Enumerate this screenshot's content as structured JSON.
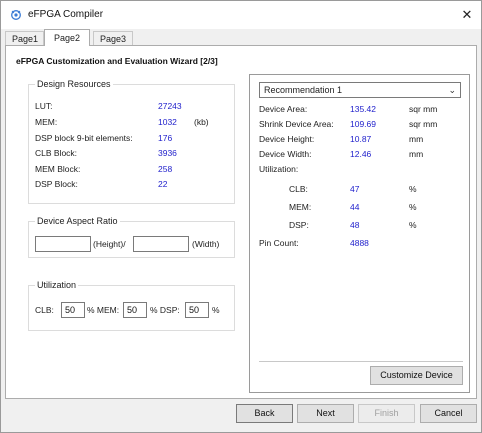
{
  "window": {
    "title": "eFPGA Compiler"
  },
  "tabs": [
    {
      "label": "Page1"
    },
    {
      "label": "Page2"
    },
    {
      "label": "Page3"
    }
  ],
  "wizard_title": "eFPGA Customization and Evaluation Wizard [2/3]",
  "design_resources": {
    "label": "Design Resources",
    "rows": [
      {
        "key": "LUT:",
        "value": "27243",
        "unit": ""
      },
      {
        "key": "MEM:",
        "value": "1032",
        "unit": "(kb)"
      },
      {
        "key": "DSP block 9-bit elements:",
        "value": "176",
        "unit": ""
      },
      {
        "key": "CLB Block:",
        "value": "3936",
        "unit": ""
      },
      {
        "key": "MEM Block:",
        "value": "258",
        "unit": ""
      },
      {
        "key": "DSP Block:",
        "value": "22",
        "unit": ""
      }
    ]
  },
  "aspect_ratio": {
    "label": "Device Aspect Ratio",
    "height_value": "",
    "height_label": "(Height)/",
    "width_value": "",
    "width_label": "(Width)"
  },
  "utilization_input": {
    "label": "Utilization",
    "clb_label": "CLB:",
    "clb_value": "50",
    "mem_label": "% MEM:",
    "mem_value": "50",
    "dsp_label": "% DSP:",
    "dsp_value": "50",
    "end_label": "%"
  },
  "recommendation": {
    "selected": "Recommendation 1",
    "rows": [
      {
        "key": "Device Area:",
        "value": "135.42",
        "unit": "sqr mm"
      },
      {
        "key": "Shrink Device Area:",
        "value": "109.69",
        "unit": "sqr mm"
      },
      {
        "key": "Device Height:",
        "value": "10.87",
        "unit": "mm"
      },
      {
        "key": "Device Width:",
        "value": "12.46",
        "unit": "mm"
      }
    ],
    "utilization_label": "Utilization:",
    "util_rows": [
      {
        "key": "CLB:",
        "value": "47",
        "unit": "%"
      },
      {
        "key": "MEM:",
        "value": "44",
        "unit": "%"
      },
      {
        "key": "DSP:",
        "value": "48",
        "unit": "%"
      }
    ],
    "pin_count_label": "Pin Count:",
    "pin_count_value": "4888",
    "customize_label": "Customize Device"
  },
  "footer": {
    "back": "Back",
    "next": "Next",
    "finish": "Finish",
    "cancel": "Cancel"
  }
}
